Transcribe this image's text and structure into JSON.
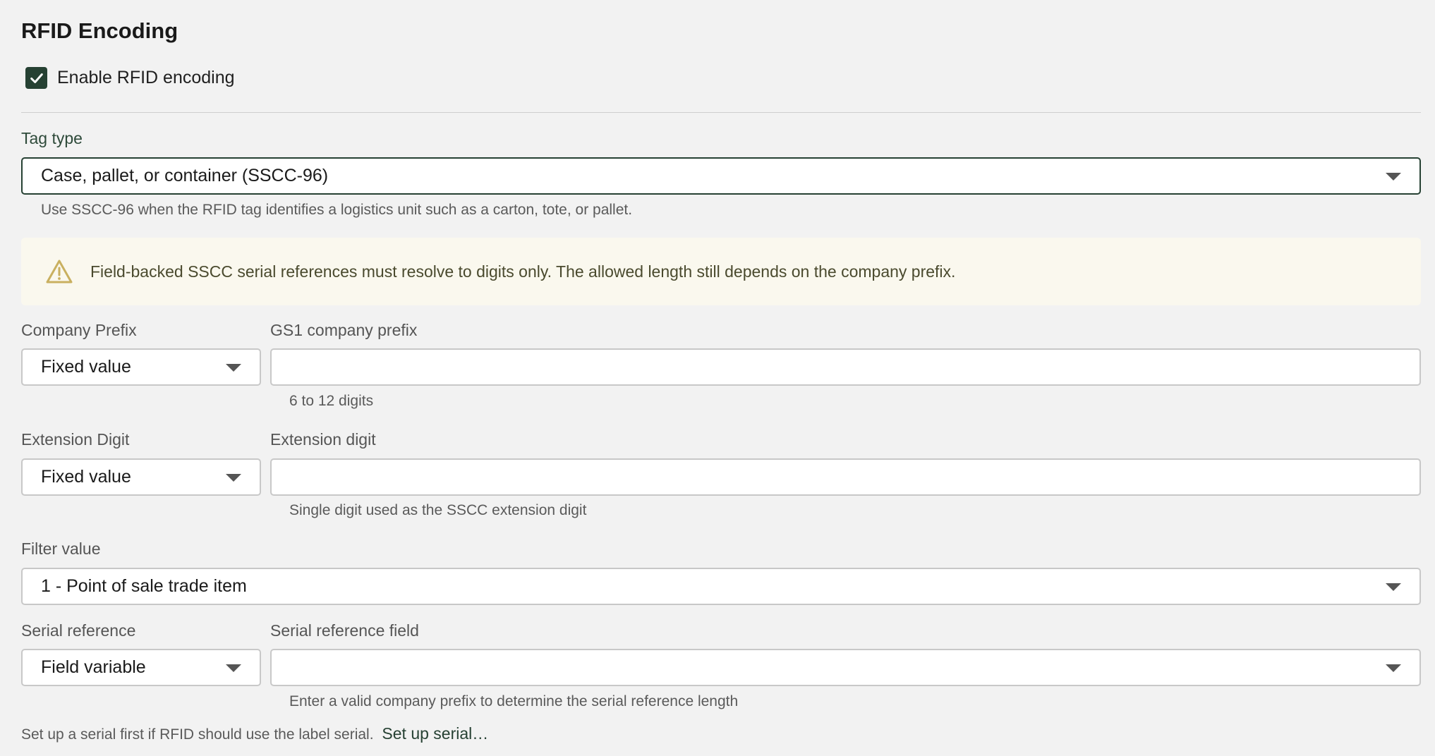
{
  "section": {
    "title": "RFID Encoding",
    "enable_label": "Enable RFID encoding",
    "enable_checked": true
  },
  "tag_type": {
    "label": "Tag type",
    "value": "Case, pallet, or container (SSCC-96)",
    "help": "Use SSCC-96 when the RFID tag identifies a logistics unit such as a carton, tote, or pallet."
  },
  "warning": {
    "text": "Field-backed SSCC serial references must resolve to digits only. The allowed length still depends on the company prefix."
  },
  "company_prefix": {
    "label": "Company Prefix",
    "mode": "Fixed value",
    "field_label": "GS1 company prefix",
    "field_value": "",
    "help": "6 to 12 digits"
  },
  "extension_digit": {
    "label": "Extension Digit",
    "mode": "Fixed value",
    "field_label": "Extension digit",
    "field_value": "",
    "help": "Single digit used as the SSCC extension digit"
  },
  "filter_value": {
    "label": "Filter value",
    "value": "1 - Point of sale trade item"
  },
  "serial_reference": {
    "label": "Serial reference",
    "mode": "Field variable",
    "field_label": "Serial reference field",
    "field_value": "",
    "help": "Enter a valid company prefix to determine the serial reference length"
  },
  "footer": {
    "text": "Set up a serial first if RFID should use the label serial.",
    "link": "Set up serial…"
  },
  "colors": {
    "accent": "#264133",
    "background": "#f2f2f2",
    "warning_bg": "#faf8ee",
    "warning_icon": "#c9b060"
  }
}
